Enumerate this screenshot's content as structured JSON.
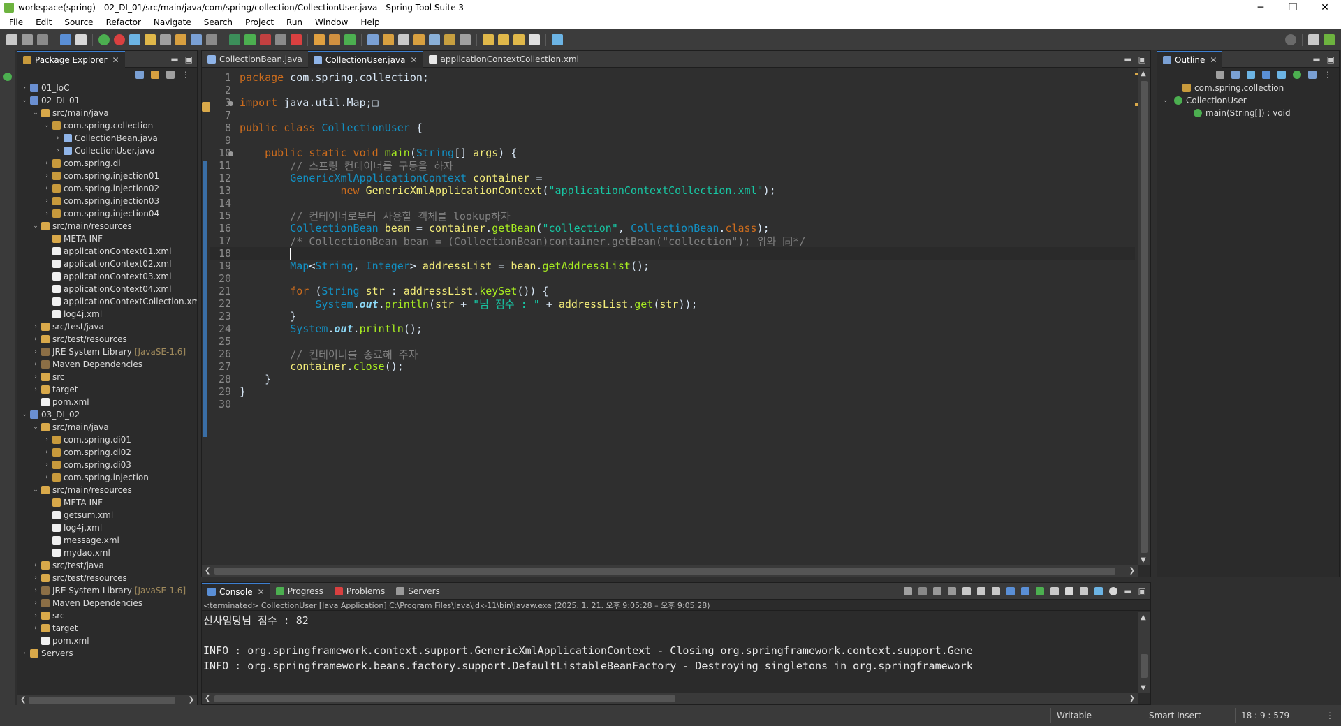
{
  "window": {
    "title": "workspace(spring) - 02_DI_01/src/main/java/com/spring/collection/CollectionUser.java - Spring Tool Suite 3",
    "controls": [
      "─",
      "❐",
      "✕"
    ]
  },
  "menu": [
    "File",
    "Edit",
    "Source",
    "Refactor",
    "Navigate",
    "Search",
    "Project",
    "Run",
    "Window",
    "Help"
  ],
  "package_explorer": {
    "title": "Package Explorer",
    "tree": [
      {
        "label": "01_IoC",
        "icon": "project-icon",
        "arrow": "›",
        "indent": 0
      },
      {
        "label": "02_DI_01",
        "icon": "project-icon",
        "arrow": "⌄",
        "indent": 0
      },
      {
        "label": "src/main/java",
        "icon": "source-folder-icon",
        "arrow": "⌄",
        "indent": 1
      },
      {
        "label": "com.spring.collection",
        "icon": "package-icon",
        "arrow": "⌄",
        "indent": 2
      },
      {
        "label": "CollectionBean.java",
        "icon": "java-file-icon",
        "arrow": "›",
        "indent": 3
      },
      {
        "label": "CollectionUser.java",
        "icon": "java-file-icon",
        "arrow": "›",
        "indent": 3
      },
      {
        "label": "com.spring.di",
        "icon": "package-icon",
        "arrow": "›",
        "indent": 2
      },
      {
        "label": "com.spring.injection01",
        "icon": "package-icon",
        "arrow": "›",
        "indent": 2
      },
      {
        "label": "com.spring.injection02",
        "icon": "package-icon",
        "arrow": "›",
        "indent": 2
      },
      {
        "label": "com.spring.injection03",
        "icon": "package-icon",
        "arrow": "›",
        "indent": 2
      },
      {
        "label": "com.spring.injection04",
        "icon": "package-icon",
        "arrow": "›",
        "indent": 2
      },
      {
        "label": "src/main/resources",
        "icon": "source-folder-icon",
        "arrow": "⌄",
        "indent": 1
      },
      {
        "label": "META-INF",
        "icon": "folder-icon",
        "arrow": "",
        "indent": 2
      },
      {
        "label": "applicationContext01.xml",
        "icon": "xml-file-icon",
        "arrow": "",
        "indent": 2
      },
      {
        "label": "applicationContext02.xml",
        "icon": "xml-file-icon",
        "arrow": "",
        "indent": 2
      },
      {
        "label": "applicationContext03.xml",
        "icon": "xml-file-icon",
        "arrow": "",
        "indent": 2
      },
      {
        "label": "applicationContext04.xml",
        "icon": "xml-file-icon",
        "arrow": "",
        "indent": 2
      },
      {
        "label": "applicationContextCollection.xml",
        "icon": "xml-file-icon",
        "arrow": "",
        "indent": 2
      },
      {
        "label": "log4j.xml",
        "icon": "xml-file-icon",
        "arrow": "",
        "indent": 2
      },
      {
        "label": "src/test/java",
        "icon": "source-folder-icon",
        "arrow": "›",
        "indent": 1
      },
      {
        "label": "src/test/resources",
        "icon": "source-folder-icon",
        "arrow": "›",
        "indent": 1
      },
      {
        "label": "JRE System Library",
        "suffix": "[JavaSE-1.6]",
        "icon": "library-icon",
        "arrow": "›",
        "indent": 1
      },
      {
        "label": "Maven Dependencies",
        "icon": "library-icon",
        "arrow": "›",
        "indent": 1
      },
      {
        "label": "src",
        "icon": "folder-icon",
        "arrow": "›",
        "indent": 1
      },
      {
        "label": "target",
        "icon": "folder-icon",
        "arrow": "›",
        "indent": 1
      },
      {
        "label": "pom.xml",
        "icon": "xml-file-icon",
        "arrow": "",
        "indent": 1
      },
      {
        "label": "03_DI_02",
        "icon": "project-icon",
        "arrow": "⌄",
        "indent": 0
      },
      {
        "label": "src/main/java",
        "icon": "source-folder-icon",
        "arrow": "⌄",
        "indent": 1
      },
      {
        "label": "com.spring.di01",
        "icon": "package-icon",
        "arrow": "›",
        "indent": 2
      },
      {
        "label": "com.spring.di02",
        "icon": "package-icon",
        "arrow": "›",
        "indent": 2
      },
      {
        "label": "com.spring.di03",
        "icon": "package-icon",
        "arrow": "›",
        "indent": 2
      },
      {
        "label": "com.spring.injection",
        "icon": "package-icon",
        "arrow": "›",
        "indent": 2
      },
      {
        "label": "src/main/resources",
        "icon": "source-folder-icon",
        "arrow": "⌄",
        "indent": 1
      },
      {
        "label": "META-INF",
        "icon": "folder-icon",
        "arrow": "",
        "indent": 2
      },
      {
        "label": "getsum.xml",
        "icon": "xml-file-icon",
        "arrow": "",
        "indent": 2
      },
      {
        "label": "log4j.xml",
        "icon": "xml-file-icon",
        "arrow": "",
        "indent": 2
      },
      {
        "label": "message.xml",
        "icon": "xml-file-icon",
        "arrow": "",
        "indent": 2
      },
      {
        "label": "mydao.xml",
        "icon": "xml-file-icon",
        "arrow": "",
        "indent": 2
      },
      {
        "label": "src/test/java",
        "icon": "source-folder-icon",
        "arrow": "›",
        "indent": 1
      },
      {
        "label": "src/test/resources",
        "icon": "source-folder-icon",
        "arrow": "›",
        "indent": 1
      },
      {
        "label": "JRE System Library",
        "suffix": "[JavaSE-1.6]",
        "icon": "library-icon",
        "arrow": "›",
        "indent": 1
      },
      {
        "label": "Maven Dependencies",
        "icon": "library-icon",
        "arrow": "›",
        "indent": 1
      },
      {
        "label": "src",
        "icon": "folder-icon",
        "arrow": "›",
        "indent": 1
      },
      {
        "label": "target",
        "icon": "folder-icon",
        "arrow": "›",
        "indent": 1
      },
      {
        "label": "pom.xml",
        "icon": "xml-file-icon",
        "arrow": "",
        "indent": 1
      },
      {
        "label": "Servers",
        "icon": "folder-icon",
        "arrow": "›",
        "indent": 0
      }
    ]
  },
  "editor": {
    "tabs": [
      {
        "label": "CollectionBean.java",
        "active": false
      },
      {
        "label": "CollectionUser.java",
        "active": true
      },
      {
        "label": "applicationContextCollection.xml",
        "active": false
      }
    ],
    "current_line": 18,
    "lines": [
      {
        "n": "1",
        "tokens": [
          [
            "kw",
            "package"
          ],
          [
            "pl",
            " com.spring.collection;"
          ]
        ]
      },
      {
        "n": "2",
        "tokens": []
      },
      {
        "n": "3",
        "fold": true,
        "tokens": [
          [
            "kw",
            "import"
          ],
          [
            "pl",
            " java.util.Map;"
          ],
          [
            "pl",
            "□"
          ]
        ]
      },
      {
        "n": "7",
        "tokens": []
      },
      {
        "n": "8",
        "tokens": [
          [
            "kw",
            "public class "
          ],
          [
            "ty",
            "CollectionUser"
          ],
          [
            "pl",
            " {"
          ]
        ]
      },
      {
        "n": "9",
        "tokens": []
      },
      {
        "n": "10",
        "fold": true,
        "tokens": [
          [
            "pl",
            "    "
          ],
          [
            "kw",
            "public static void "
          ],
          [
            "mt",
            "main"
          ],
          [
            "pl",
            "("
          ],
          [
            "ty",
            "String"
          ],
          [
            "pl",
            "[] "
          ],
          [
            "var",
            "args"
          ],
          [
            "pl",
            ") {"
          ]
        ]
      },
      {
        "n": "11",
        "tokens": [
          [
            "pl",
            "        "
          ],
          [
            "cm",
            "// 스프링 컨테이너를 구동을 하자"
          ]
        ]
      },
      {
        "n": "12",
        "tokens": [
          [
            "pl",
            "        "
          ],
          [
            "ty",
            "GenericXmlApplicationContext"
          ],
          [
            "pl",
            " "
          ],
          [
            "var",
            "container"
          ],
          [
            "pl",
            " ="
          ]
        ]
      },
      {
        "n": "13",
        "tokens": [
          [
            "pl",
            "                "
          ],
          [
            "kw",
            "new "
          ],
          [
            "var",
            "GenericXmlApplicationContext"
          ],
          [
            "pl",
            "("
          ],
          [
            "str",
            "\"applicationContextCollection.xml\""
          ],
          [
            "pl",
            ");"
          ]
        ]
      },
      {
        "n": "14",
        "tokens": []
      },
      {
        "n": "15",
        "tokens": [
          [
            "pl",
            "        "
          ],
          [
            "cm",
            "// 컨테이너로부터 사용할 객체를 lookup하자"
          ]
        ]
      },
      {
        "n": "16",
        "tokens": [
          [
            "pl",
            "        "
          ],
          [
            "ty",
            "CollectionBean"
          ],
          [
            "pl",
            " "
          ],
          [
            "var",
            "bean"
          ],
          [
            "pl",
            " = "
          ],
          [
            "var",
            "container"
          ],
          [
            "pl",
            "."
          ],
          [
            "mt",
            "getBean"
          ],
          [
            "pl",
            "("
          ],
          [
            "str",
            "\"collection\""
          ],
          [
            "pl",
            ", "
          ],
          [
            "ty",
            "CollectionBean"
          ],
          [
            "pl",
            "."
          ],
          [
            "kw",
            "class"
          ],
          [
            "pl",
            ");"
          ]
        ]
      },
      {
        "n": "17",
        "tokens": [
          [
            "pl",
            "        "
          ],
          [
            "cm",
            "/* CollectionBean bean = (CollectionBean)container.getBean(\"collection\"); 위와 同*/"
          ]
        ]
      },
      {
        "n": "18",
        "tokens": [
          [
            "pl",
            "        "
          ]
        ],
        "caret": true
      },
      {
        "n": "19",
        "tokens": [
          [
            "pl",
            "        "
          ],
          [
            "ty",
            "Map"
          ],
          [
            "pl",
            "<"
          ],
          [
            "ty",
            "String"
          ],
          [
            "pl",
            ", "
          ],
          [
            "ty",
            "Integer"
          ],
          [
            "pl",
            "> "
          ],
          [
            "var",
            "addressList"
          ],
          [
            "pl",
            " = "
          ],
          [
            "var",
            "bean"
          ],
          [
            "pl",
            "."
          ],
          [
            "mt",
            "getAddressList"
          ],
          [
            "pl",
            "();"
          ]
        ]
      },
      {
        "n": "20",
        "tokens": []
      },
      {
        "n": "21",
        "tokens": [
          [
            "pl",
            "        "
          ],
          [
            "kw",
            "for"
          ],
          [
            "pl",
            " ("
          ],
          [
            "ty",
            "String"
          ],
          [
            "pl",
            " "
          ],
          [
            "var",
            "str"
          ],
          [
            "pl",
            " : "
          ],
          [
            "var",
            "addressList"
          ],
          [
            "pl",
            "."
          ],
          [
            "mt",
            "keySet"
          ],
          [
            "pl",
            "()) {"
          ]
        ]
      },
      {
        "n": "22",
        "tokens": [
          [
            "pl",
            "            "
          ],
          [
            "ty",
            "System"
          ],
          [
            "pl",
            "."
          ],
          [
            "st",
            "out"
          ],
          [
            "pl",
            "."
          ],
          [
            "mt",
            "println"
          ],
          [
            "pl",
            "("
          ],
          [
            "var",
            "str"
          ],
          [
            "pl",
            " + "
          ],
          [
            "str",
            "\"님 점수 : \""
          ],
          [
            "pl",
            " + "
          ],
          [
            "var",
            "addressList"
          ],
          [
            "pl",
            "."
          ],
          [
            "mt",
            "get"
          ],
          [
            "pl",
            "("
          ],
          [
            "var",
            "str"
          ],
          [
            "pl",
            "));"
          ]
        ]
      },
      {
        "n": "23",
        "tokens": [
          [
            "pl",
            "        }"
          ]
        ]
      },
      {
        "n": "24",
        "tokens": [
          [
            "pl",
            "        "
          ],
          [
            "ty",
            "System"
          ],
          [
            "pl",
            "."
          ],
          [
            "st",
            "out"
          ],
          [
            "pl",
            "."
          ],
          [
            "mt",
            "println"
          ],
          [
            "pl",
            "();"
          ]
        ]
      },
      {
        "n": "25",
        "tokens": []
      },
      {
        "n": "26",
        "tokens": [
          [
            "pl",
            "        "
          ],
          [
            "cm",
            "// 컨테이너를 종료해 주자"
          ]
        ]
      },
      {
        "n": "27",
        "tokens": [
          [
            "pl",
            "        "
          ],
          [
            "var",
            "container"
          ],
          [
            "pl",
            "."
          ],
          [
            "mt",
            "close"
          ],
          [
            "pl",
            "();"
          ]
        ]
      },
      {
        "n": "28",
        "tokens": [
          [
            "pl",
            "    }"
          ]
        ]
      },
      {
        "n": "29",
        "tokens": [
          [
            "pl",
            "}"
          ]
        ]
      },
      {
        "n": "30",
        "tokens": []
      }
    ]
  },
  "outline": {
    "title": "Outline",
    "items": [
      {
        "label": "com.spring.collection",
        "icon": "package-declaration-icon",
        "arrow": ""
      },
      {
        "label": "CollectionUser",
        "icon": "class-icon",
        "arrow": "⌄"
      },
      {
        "label": "main(String[]) : void",
        "icon": "method-icon",
        "arrow": ""
      }
    ]
  },
  "console": {
    "tabs": [
      {
        "label": "Console",
        "active": true
      },
      {
        "label": "Progress",
        "active": false
      },
      {
        "label": "Problems",
        "active": false
      },
      {
        "label": "Servers",
        "active": false
      }
    ],
    "terminated": "<terminated> CollectionUser [Java Application] C:\\Program Files\\Java\\jdk-11\\bin\\javaw.exe  (2025. 1. 21. 오후 9:05:28 – 오후 9:05:28)",
    "lines": [
      "신사임당님 점수 : 82",
      "",
      "INFO : org.springframework.context.support.GenericXmlApplicationContext - Closing org.springframework.context.support.Gene",
      "INFO : org.springframework.beans.factory.support.DefaultListableBeanFactory - Destroying singletons in org.springframework"
    ]
  },
  "status": {
    "writable": "Writable",
    "insert_mode": "Smart Insert",
    "position": "18 : 9 : 579"
  },
  "colors": {
    "accent": "#3d7fd1",
    "keyword": "#cc6c1d",
    "type": "#1290c3",
    "string": "#17c6a3",
    "comment": "#808080"
  }
}
